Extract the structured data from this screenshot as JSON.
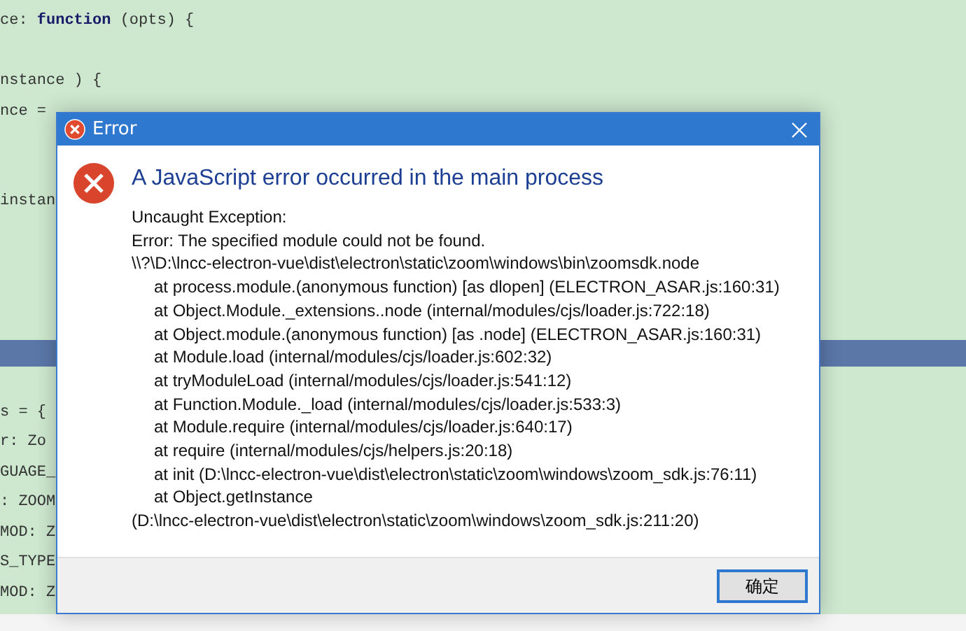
{
  "editor": {
    "lines": [
      {
        "kind": "code",
        "text": "ce: **function** (opts) {"
      },
      {
        "kind": "blank"
      },
      {
        "kind": "code",
        "text": "nstance ) {"
      },
      {
        "kind": "code",
        "text": "nce ="
      },
      {
        "kind": "blank"
      },
      {
        "kind": "blank"
      },
      {
        "kind": "code",
        "text": "instan"
      },
      {
        "kind": "blank"
      },
      {
        "kind": "blank"
      },
      {
        "kind": "blank"
      },
      {
        "kind": "blank"
      },
      {
        "kind": "highlight"
      },
      {
        "kind": "blank"
      },
      {
        "kind": "code",
        "text": "s = {"
      },
      {
        "kind": "code",
        "text": "r: Zo"
      },
      {
        "kind": "code",
        "text": "GUAGE_"
      },
      {
        "kind": "code",
        "text": ": ZOOM"
      },
      {
        "kind": "code",
        "text": "MOD: Z"
      },
      {
        "kind": "code",
        "text": "S_TYPE"
      },
      {
        "kind": "code",
        "text": "MOD: Z"
      }
    ]
  },
  "dialog": {
    "title": "Error",
    "heading": "A JavaScript error occurred in the main process",
    "message_lines": [
      {
        "kind": "plain",
        "text": "Uncaught Exception:"
      },
      {
        "kind": "plain",
        "text": "Error: The specified module could not be found."
      },
      {
        "kind": "plain",
        "text": "\\\\?\\D:\\lncc-electron-vue\\dist\\electron\\static\\zoom\\windows\\bin\\zoomsdk.node"
      },
      {
        "kind": "stack",
        "text": "at process.module.(anonymous function) [as dlopen] (ELECTRON_ASAR.js:160:31)"
      },
      {
        "kind": "stack",
        "text": "at Object.Module._extensions..node (internal/modules/cjs/loader.js:722:18)"
      },
      {
        "kind": "stack",
        "text": "at Object.module.(anonymous function) [as .node] (ELECTRON_ASAR.js:160:31)"
      },
      {
        "kind": "stack",
        "text": "at Module.load (internal/modules/cjs/loader.js:602:32)"
      },
      {
        "kind": "stack",
        "text": "at tryModuleLoad (internal/modules/cjs/loader.js:541:12)"
      },
      {
        "kind": "stack",
        "text": "at Function.Module._load (internal/modules/cjs/loader.js:533:3)"
      },
      {
        "kind": "stack",
        "text": "at Module.require (internal/modules/cjs/loader.js:640:17)"
      },
      {
        "kind": "stack",
        "text": "at require (internal/modules/cjs/helpers.js:20:18)"
      },
      {
        "kind": "stack",
        "text": "at init (D:\\lncc-electron-vue\\dist\\electron\\static\\zoom\\windows\\zoom_sdk.js:76:11)"
      },
      {
        "kind": "stack",
        "text": "at Object.getInstance"
      },
      {
        "kind": "plain",
        "text": "(D:\\lncc-electron-vue\\dist\\electron\\static\\zoom\\windows\\zoom_sdk.js:211:20)"
      }
    ],
    "buttons": [
      {
        "label": "确定",
        "selected": true
      }
    ]
  }
}
